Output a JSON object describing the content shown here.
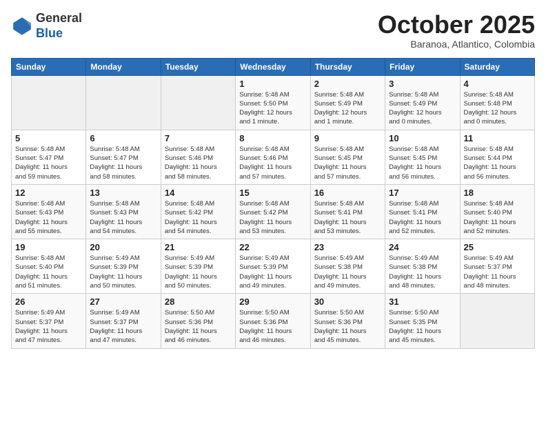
{
  "header": {
    "logo_general": "General",
    "logo_blue": "Blue",
    "month_title": "October 2025",
    "location": "Baranoa, Atlantico, Colombia"
  },
  "weekdays": [
    "Sunday",
    "Monday",
    "Tuesday",
    "Wednesday",
    "Thursday",
    "Friday",
    "Saturday"
  ],
  "weeks": [
    [
      {
        "day": "",
        "info": ""
      },
      {
        "day": "",
        "info": ""
      },
      {
        "day": "",
        "info": ""
      },
      {
        "day": "1",
        "info": "Sunrise: 5:48 AM\nSunset: 5:50 PM\nDaylight: 12 hours\nand 1 minute."
      },
      {
        "day": "2",
        "info": "Sunrise: 5:48 AM\nSunset: 5:49 PM\nDaylight: 12 hours\nand 1 minute."
      },
      {
        "day": "3",
        "info": "Sunrise: 5:48 AM\nSunset: 5:49 PM\nDaylight: 12 hours\nand 0 minutes."
      },
      {
        "day": "4",
        "info": "Sunrise: 5:48 AM\nSunset: 5:48 PM\nDaylight: 12 hours\nand 0 minutes."
      }
    ],
    [
      {
        "day": "5",
        "info": "Sunrise: 5:48 AM\nSunset: 5:47 PM\nDaylight: 11 hours\nand 59 minutes."
      },
      {
        "day": "6",
        "info": "Sunrise: 5:48 AM\nSunset: 5:47 PM\nDaylight: 11 hours\nand 58 minutes."
      },
      {
        "day": "7",
        "info": "Sunrise: 5:48 AM\nSunset: 5:46 PM\nDaylight: 11 hours\nand 58 minutes."
      },
      {
        "day": "8",
        "info": "Sunrise: 5:48 AM\nSunset: 5:46 PM\nDaylight: 11 hours\nand 57 minutes."
      },
      {
        "day": "9",
        "info": "Sunrise: 5:48 AM\nSunset: 5:45 PM\nDaylight: 11 hours\nand 57 minutes."
      },
      {
        "day": "10",
        "info": "Sunrise: 5:48 AM\nSunset: 5:45 PM\nDaylight: 11 hours\nand 56 minutes."
      },
      {
        "day": "11",
        "info": "Sunrise: 5:48 AM\nSunset: 5:44 PM\nDaylight: 11 hours\nand 56 minutes."
      }
    ],
    [
      {
        "day": "12",
        "info": "Sunrise: 5:48 AM\nSunset: 5:43 PM\nDaylight: 11 hours\nand 55 minutes."
      },
      {
        "day": "13",
        "info": "Sunrise: 5:48 AM\nSunset: 5:43 PM\nDaylight: 11 hours\nand 54 minutes."
      },
      {
        "day": "14",
        "info": "Sunrise: 5:48 AM\nSunset: 5:42 PM\nDaylight: 11 hours\nand 54 minutes."
      },
      {
        "day": "15",
        "info": "Sunrise: 5:48 AM\nSunset: 5:42 PM\nDaylight: 11 hours\nand 53 minutes."
      },
      {
        "day": "16",
        "info": "Sunrise: 5:48 AM\nSunset: 5:41 PM\nDaylight: 11 hours\nand 53 minutes."
      },
      {
        "day": "17",
        "info": "Sunrise: 5:48 AM\nSunset: 5:41 PM\nDaylight: 11 hours\nand 52 minutes."
      },
      {
        "day": "18",
        "info": "Sunrise: 5:48 AM\nSunset: 5:40 PM\nDaylight: 11 hours\nand 52 minutes."
      }
    ],
    [
      {
        "day": "19",
        "info": "Sunrise: 5:48 AM\nSunset: 5:40 PM\nDaylight: 11 hours\nand 51 minutes."
      },
      {
        "day": "20",
        "info": "Sunrise: 5:49 AM\nSunset: 5:39 PM\nDaylight: 11 hours\nand 50 minutes."
      },
      {
        "day": "21",
        "info": "Sunrise: 5:49 AM\nSunset: 5:39 PM\nDaylight: 11 hours\nand 50 minutes."
      },
      {
        "day": "22",
        "info": "Sunrise: 5:49 AM\nSunset: 5:39 PM\nDaylight: 11 hours\nand 49 minutes."
      },
      {
        "day": "23",
        "info": "Sunrise: 5:49 AM\nSunset: 5:38 PM\nDaylight: 11 hours\nand 49 minutes."
      },
      {
        "day": "24",
        "info": "Sunrise: 5:49 AM\nSunset: 5:38 PM\nDaylight: 11 hours\nand 48 minutes."
      },
      {
        "day": "25",
        "info": "Sunrise: 5:49 AM\nSunset: 5:37 PM\nDaylight: 11 hours\nand 48 minutes."
      }
    ],
    [
      {
        "day": "26",
        "info": "Sunrise: 5:49 AM\nSunset: 5:37 PM\nDaylight: 11 hours\nand 47 minutes."
      },
      {
        "day": "27",
        "info": "Sunrise: 5:49 AM\nSunset: 5:37 PM\nDaylight: 11 hours\nand 47 minutes."
      },
      {
        "day": "28",
        "info": "Sunrise: 5:50 AM\nSunset: 5:36 PM\nDaylight: 11 hours\nand 46 minutes."
      },
      {
        "day": "29",
        "info": "Sunrise: 5:50 AM\nSunset: 5:36 PM\nDaylight: 11 hours\nand 46 minutes."
      },
      {
        "day": "30",
        "info": "Sunrise: 5:50 AM\nSunset: 5:36 PM\nDaylight: 11 hours\nand 45 minutes."
      },
      {
        "day": "31",
        "info": "Sunrise: 5:50 AM\nSunset: 5:35 PM\nDaylight: 11 hours\nand 45 minutes."
      },
      {
        "day": "",
        "info": ""
      }
    ]
  ]
}
